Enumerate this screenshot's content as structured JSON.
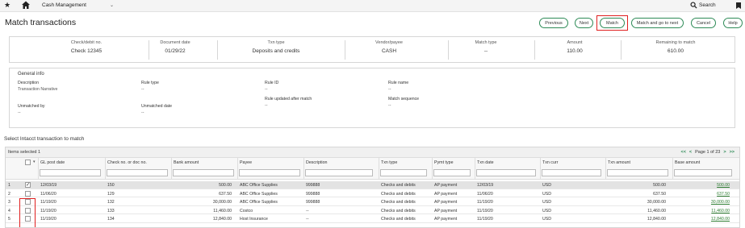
{
  "topbar": {
    "app_name": "Cash Management",
    "search_label": "Search"
  },
  "page": {
    "title": "Match transactions"
  },
  "actions": {
    "previous": "Previous",
    "next": "Next",
    "match": "Match",
    "match_next": "Match and go to next",
    "cancel": "Cancel",
    "help": "Help"
  },
  "summary": {
    "check": {
      "label": "Check/debit no.",
      "value": "Check 12345"
    },
    "doc_date": {
      "label": "Document date",
      "value": "01/29/22"
    },
    "txn_type": {
      "label": "Txn type",
      "value": "Deposits and credits"
    },
    "vendor": {
      "label": "Vendor/payee",
      "value": "CASH"
    },
    "match_type": {
      "label": "Match type",
      "value": "--"
    },
    "amount": {
      "label": "Amount",
      "value": "110.00"
    },
    "remaining": {
      "label": "Remaining to match",
      "value": "610.00"
    }
  },
  "general_info": {
    "title": "General info",
    "description": {
      "label": "Description",
      "value": "Transaction Narrative"
    },
    "rule_type": {
      "label": "Rule type",
      "value": "--"
    },
    "rule_id": {
      "label": "Rule ID",
      "value": "--"
    },
    "rule_name": {
      "label": "Rule name",
      "value": "--"
    },
    "rule_updated": {
      "label": "Rule updated after match",
      "value": "--"
    },
    "match_sequence": {
      "label": "Match sequence",
      "value": "--"
    },
    "unmatched_by": {
      "label": "Unmatched by",
      "value": "--"
    },
    "unmatched_date": {
      "label": "Unmatched date",
      "value": "--"
    }
  },
  "grid": {
    "section_title": "Select Intacct transaction to match",
    "items_selected": "Items selected 1",
    "pager": {
      "first": "<<",
      "prev": "<",
      "label": "Page 1 of 23",
      "next": ">",
      "last": ">>"
    },
    "headers": [
      "GL post date",
      "Check no. or doc no.",
      "Bank amount",
      "Payee",
      "Description",
      "Txn type",
      "Pymt type",
      "Txn date",
      "Txn curr",
      "Txn amount",
      "Base amount"
    ],
    "rows": [
      {
        "n": "1",
        "checked": true,
        "gl_date": "12/03/19",
        "check_no": "150",
        "bank_amt": "500.00",
        "payee": "ABC Office Supplies",
        "desc": "999888",
        "txn_type": "Checks and debits",
        "pymt": "AP payment",
        "txn_date": "12/03/19",
        "curr": "USD",
        "txn_amt": "500.00",
        "base_amt": "500.00"
      },
      {
        "n": "2",
        "checked": false,
        "gl_date": "11/06/20",
        "check_no": "129",
        "bank_amt": "637.50",
        "payee": "ABC Office Supplies",
        "desc": "999888",
        "txn_type": "Checks and debits",
        "pymt": "AP payment",
        "txn_date": "11/06/20",
        "curr": "USD",
        "txn_amt": "637.50",
        "base_amt": "637.50"
      },
      {
        "n": "3",
        "checked": false,
        "gl_date": "11/19/20",
        "check_no": "132",
        "bank_amt": "30,000.00",
        "payee": "ABC Office Supplies",
        "desc": "999888",
        "txn_type": "Checks and debits",
        "pymt": "AP payment",
        "txn_date": "11/19/20",
        "curr": "USD",
        "txn_amt": "30,000.00",
        "base_amt": "30,000.00"
      },
      {
        "n": "4",
        "checked": false,
        "gl_date": "11/19/20",
        "check_no": "133",
        "bank_amt": "11,460.00",
        "payee": "Costco",
        "desc": "--",
        "txn_type": "Checks and debits",
        "pymt": "AP payment",
        "txn_date": "11/19/20",
        "curr": "USD",
        "txn_amt": "11,460.00",
        "base_amt": "11,460.00"
      },
      {
        "n": "5",
        "checked": false,
        "gl_date": "11/19/20",
        "check_no": "134",
        "bank_amt": "12,840.00",
        "payee": "Host Insurance",
        "desc": "--",
        "txn_type": "Checks and debits",
        "pymt": "AP payment",
        "txn_date": "11/19/20",
        "curr": "USD",
        "txn_amt": "12,840.00",
        "base_amt": "12,840.00"
      }
    ]
  },
  "colors": {
    "accent": "#2e8b57",
    "highlight": "#e02020"
  }
}
